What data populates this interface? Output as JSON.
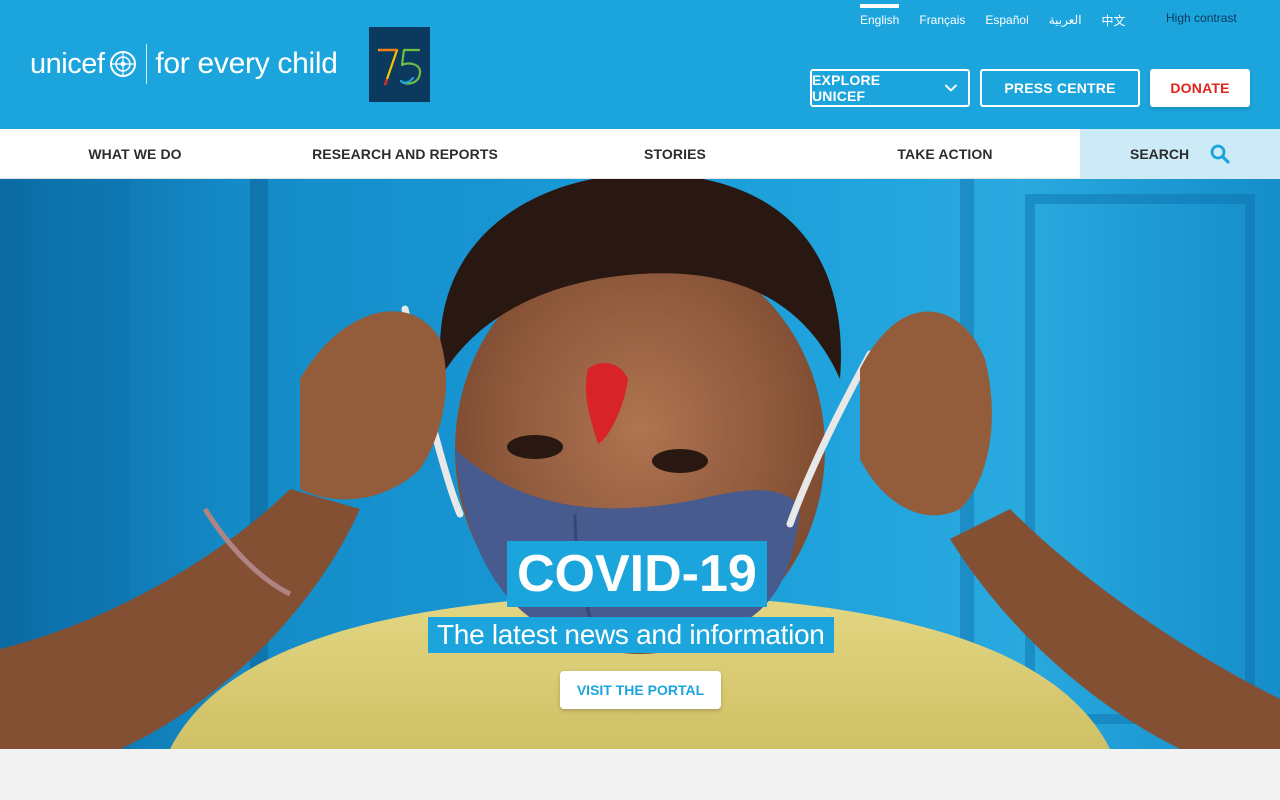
{
  "header": {
    "logo_word": "unicef",
    "logo_tagline": "for every child",
    "badge": "75",
    "languages": [
      "English",
      "Français",
      "Español",
      "العربية",
      "中文"
    ],
    "active_language": "English",
    "high_contrast": "High contrast",
    "explore_label": "EXPLORE UNICEF",
    "press_label": "PRESS CENTRE",
    "donate_label": "DONATE"
  },
  "nav": {
    "items": [
      "WHAT WE DO",
      "RESEARCH AND REPORTS",
      "STORIES",
      "TAKE ACTION"
    ],
    "search_label": "SEARCH"
  },
  "hero": {
    "title": "COVID-19",
    "subtitle": "The latest news and information",
    "cta_label": "VISIT THE PORTAL"
  },
  "colors": {
    "brand_blue": "#1ca5dc",
    "donate_red": "#e2231a",
    "search_bg": "#cdeaf7",
    "badge_navy": "#0b3a5e"
  }
}
